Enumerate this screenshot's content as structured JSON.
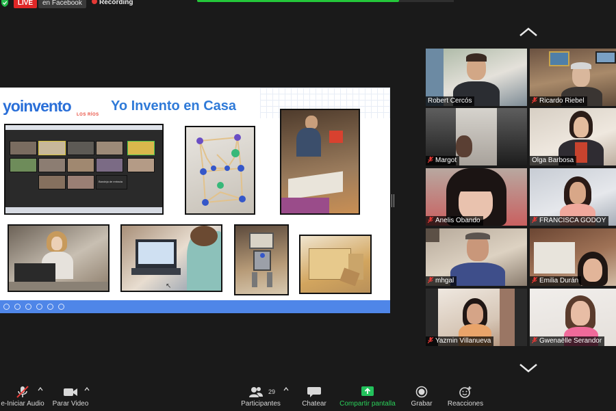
{
  "top_bar": {
    "live_label": "LIVE",
    "live_target": "en Facebook",
    "recording_label": "Recording"
  },
  "slide": {
    "logo_text": "yoinvento",
    "logo_subtitle": "LOS RÍOS",
    "title": "Yo Invento en Casa",
    "mini_screen_caption": "Bandeja de entrada"
  },
  "participants": [
    {
      "name": "Robert Cercós",
      "muted": false
    },
    {
      "name": "Ricardo Riebel",
      "muted": true
    },
    {
      "name": "Margot",
      "muted": true
    },
    {
      "name": "Olga Barbosa",
      "muted": false
    },
    {
      "name": "Anelis Obando",
      "muted": true
    },
    {
      "name": "FRANCISCA GODOY",
      "muted": true
    },
    {
      "name": "mhgal",
      "muted": true
    },
    {
      "name": "Emilia Durán",
      "muted": true
    },
    {
      "name": "Yazmin Villanueva",
      "muted": true
    },
    {
      "name": "Gwenaëlle Serandor",
      "muted": true
    }
  ],
  "toolbar": {
    "audio_label": "e-Iniciar Audio",
    "video_label": "Parar Video",
    "participants_label": "Participantes",
    "participants_count": "29",
    "chat_label": "Chatear",
    "share_label": "Compartir pantalla",
    "record_label": "Grabar",
    "reactions_label": "Reacciones"
  },
  "colors": {
    "live_red": "#e02727",
    "share_green": "#24c73a",
    "slide_blue": "#2f7ad8",
    "slide_toolbar": "#4f86e8",
    "mute_red": "#e53935"
  },
  "icons": [
    "shield-icon",
    "mic-off-icon",
    "video-icon",
    "participants-icon",
    "chat-icon",
    "share-screen-icon",
    "record-icon",
    "reactions-icon",
    "chevron-up-icon",
    "chevron-down-icon"
  ]
}
